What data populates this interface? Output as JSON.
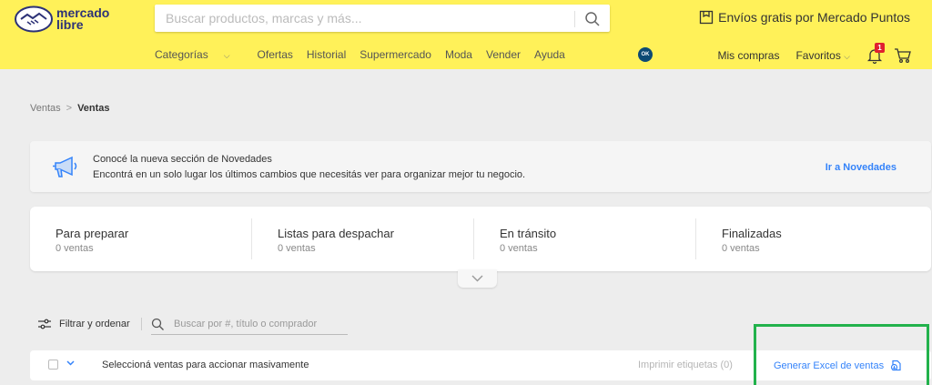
{
  "header": {
    "logo": {
      "line1": "mercado",
      "line2": "libre"
    },
    "search": {
      "placeholder": "Buscar productos, marcas y más..."
    },
    "promo": "Envíos gratis por Mercado Puntos",
    "nav": [
      "Categorías",
      "Ofertas",
      "Historial",
      "Supermercado",
      "Moda",
      "Vender",
      "Ayuda"
    ],
    "nav_chevron": "⌵",
    "nav_disc": "OK",
    "right_nav": {
      "purchases": "Mis compras",
      "favorites": "Favoritos",
      "notification_count": "1"
    }
  },
  "breadcrumb": {
    "parent": "Ventas",
    "separator": ">",
    "current": "Ventas"
  },
  "notice": {
    "title": "Conocé la nueva sección de Novedades",
    "text": "Encontrá en un solo lugar los últimos cambios que necesitás ver para organizar mejor tu negocio.",
    "link": "Ir a Novedades"
  },
  "tabs": [
    {
      "title": "Para preparar",
      "count": "0 ventas"
    },
    {
      "title": "Listas para despachar",
      "count": "0 ventas"
    },
    {
      "title": "En tránsito",
      "count": "0 ventas"
    },
    {
      "title": "Finalizadas",
      "count": "0 ventas"
    }
  ],
  "filters": {
    "label": "Filtrar y ordenar",
    "search_placeholder": "Buscar por #, título o comprador"
  },
  "bulk": {
    "label": "Seleccioná ventas para accionar masivamente",
    "print": "Imprimir etiquetas (0)",
    "excel": "Generar Excel de ventas"
  },
  "colors": {
    "brand_yellow": "#fff159",
    "link_blue": "#3483fa",
    "highlight_green": "#22b24c"
  }
}
